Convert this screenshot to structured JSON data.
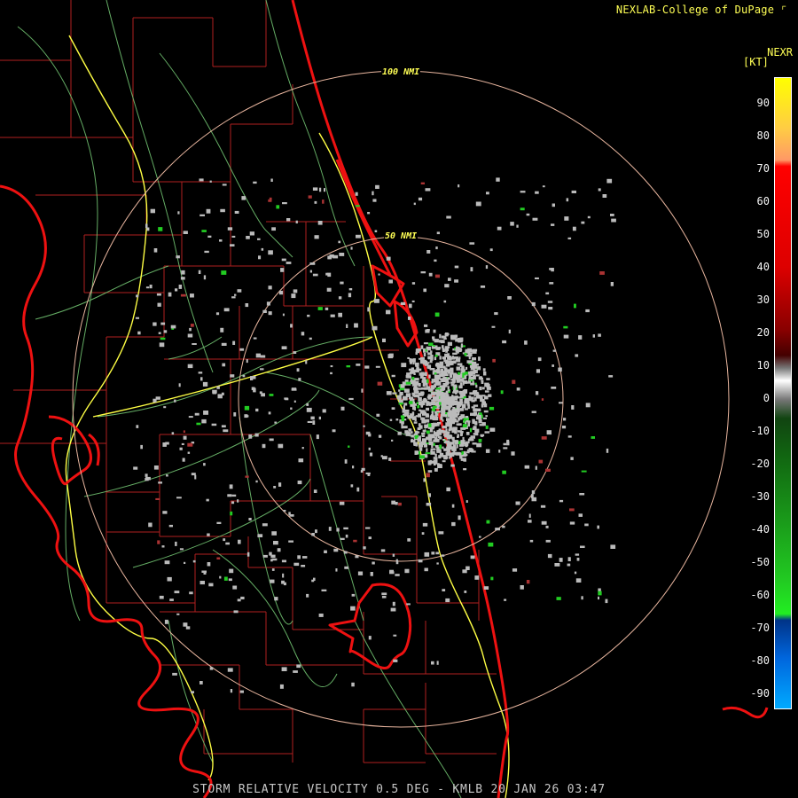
{
  "header": {
    "credit": "NEXLAB-College of DuPage",
    "credit_icon": "corner-mark-icon"
  },
  "legend": {
    "product": "NEXR",
    "unit": "[KT]",
    "ticks": [
      "90",
      "80",
      "70",
      "60",
      "50",
      "40",
      "30",
      "20",
      "10",
      "0",
      "-10",
      "-20",
      "-30",
      "-40",
      "-50",
      "-60",
      "-70",
      "-80",
      "-90"
    ],
    "colors": {
      "inbound_strong": "#0066dd",
      "inbound": "#22cc22",
      "near_zero": "#bbbbbb",
      "outbound": "#aa0000",
      "outbound_strong": "#ff0000",
      "outbound_extreme": "#ffff00"
    }
  },
  "range_rings": {
    "inner_label": "50 NMI",
    "outer_label": "100 NMI"
  },
  "caption": "STORM RELATIVE VELOCITY 0.5 DEG - KMLB 20 JAN 26 03:47",
  "colors": {
    "background": "#000000",
    "state_outline": "#ee1111",
    "county_lines": "#b02020",
    "highway": "#ffff44",
    "roads": "#77cc77",
    "range_ring": "#e9b69f",
    "text_yellow": "#ffff55"
  }
}
